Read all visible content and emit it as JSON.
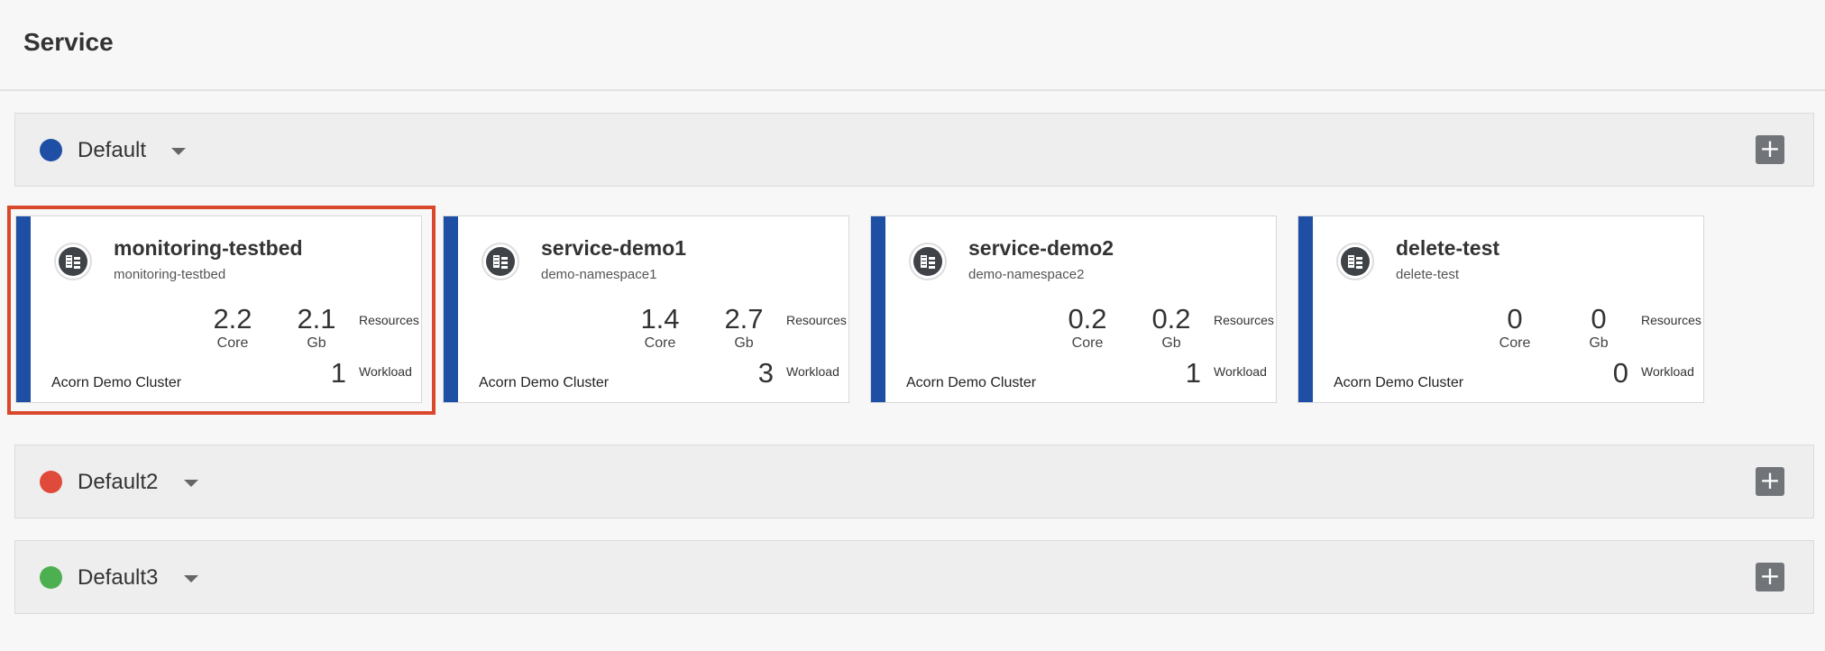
{
  "page": {
    "title": "Service"
  },
  "groups": [
    {
      "name": "Default",
      "color": "#1f4fa5",
      "add_label": "+"
    },
    {
      "name": "Default2",
      "color": "#e04a3a",
      "add_label": "+"
    },
    {
      "name": "Default3",
      "color": "#4caf50",
      "add_label": "+"
    }
  ],
  "services": [
    {
      "name": "monitoring-testbed",
      "namespace": "monitoring-testbed",
      "core": "2.2",
      "core_unit": "Core",
      "memory": "2.1",
      "memory_unit": "Gb",
      "resources_label": "Resources",
      "workload": "1",
      "workload_label": "Workload",
      "cluster": "Acorn Demo Cluster",
      "selected": true
    },
    {
      "name": "service-demo1",
      "namespace": "demo-namespace1",
      "core": "1.4",
      "core_unit": "Core",
      "memory": "2.7",
      "memory_unit": "Gb",
      "resources_label": "Resources",
      "workload": "3",
      "workload_label": "Workload",
      "cluster": "Acorn Demo Cluster"
    },
    {
      "name": "service-demo2",
      "namespace": "demo-namespace2",
      "core": "0.2",
      "core_unit": "Core",
      "memory": "0.2",
      "memory_unit": "Gb",
      "resources_label": "Resources",
      "workload": "1",
      "workload_label": "Workload",
      "cluster": "Acorn Demo Cluster"
    },
    {
      "name": "delete-test",
      "namespace": "delete-test",
      "core": "0",
      "core_unit": "Core",
      "memory": "0",
      "memory_unit": "Gb",
      "resources_label": "Resources",
      "workload": "0",
      "workload_label": "Workload",
      "cluster": "Acorn Demo Cluster"
    }
  ],
  "icons": {
    "service": "service-cluster-icon",
    "add": "plus-icon",
    "expand": "chevron-down-icon"
  },
  "colors": {
    "card_accent": "#1f4fa5",
    "selection": "#d9482b"
  }
}
